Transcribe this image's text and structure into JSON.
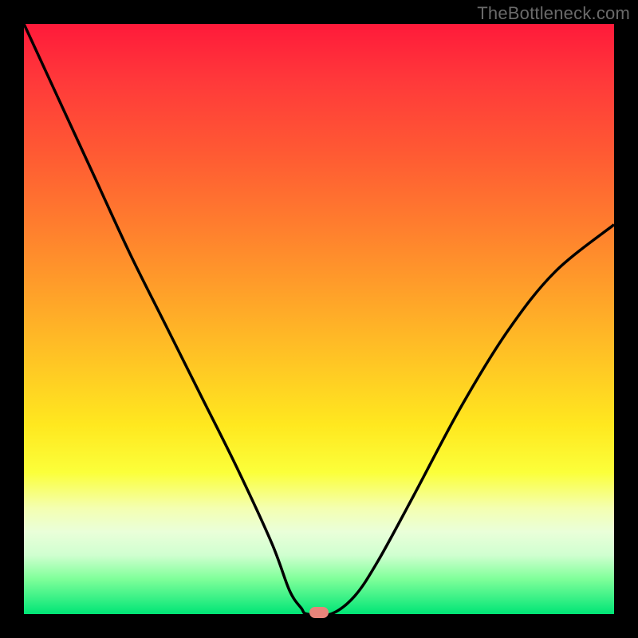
{
  "watermark": "TheBottleneck.com",
  "chart_data": {
    "type": "line",
    "title": "",
    "xlabel": "",
    "ylabel": "",
    "xlim": [
      0,
      1
    ],
    "ylim": [
      0,
      1
    ],
    "background_gradient": {
      "top_color": "#ff1a3a",
      "mid_color": "#ffe81f",
      "bottom_color": "#00e576"
    },
    "series": [
      {
        "name": "bottleneck-curve",
        "x": [
          0.0,
          0.06,
          0.12,
          0.18,
          0.24,
          0.3,
          0.36,
          0.42,
          0.45,
          0.47,
          0.48,
          0.52,
          0.56,
          0.6,
          0.66,
          0.74,
          0.82,
          0.9,
          1.0
        ],
        "y": [
          1.0,
          0.87,
          0.74,
          0.61,
          0.49,
          0.37,
          0.25,
          0.12,
          0.04,
          0.01,
          0.0,
          0.0,
          0.03,
          0.09,
          0.2,
          0.35,
          0.48,
          0.58,
          0.66
        ]
      }
    ],
    "marker": {
      "x": 0.5,
      "y": 0.003,
      "color": "#e8847a"
    }
  }
}
